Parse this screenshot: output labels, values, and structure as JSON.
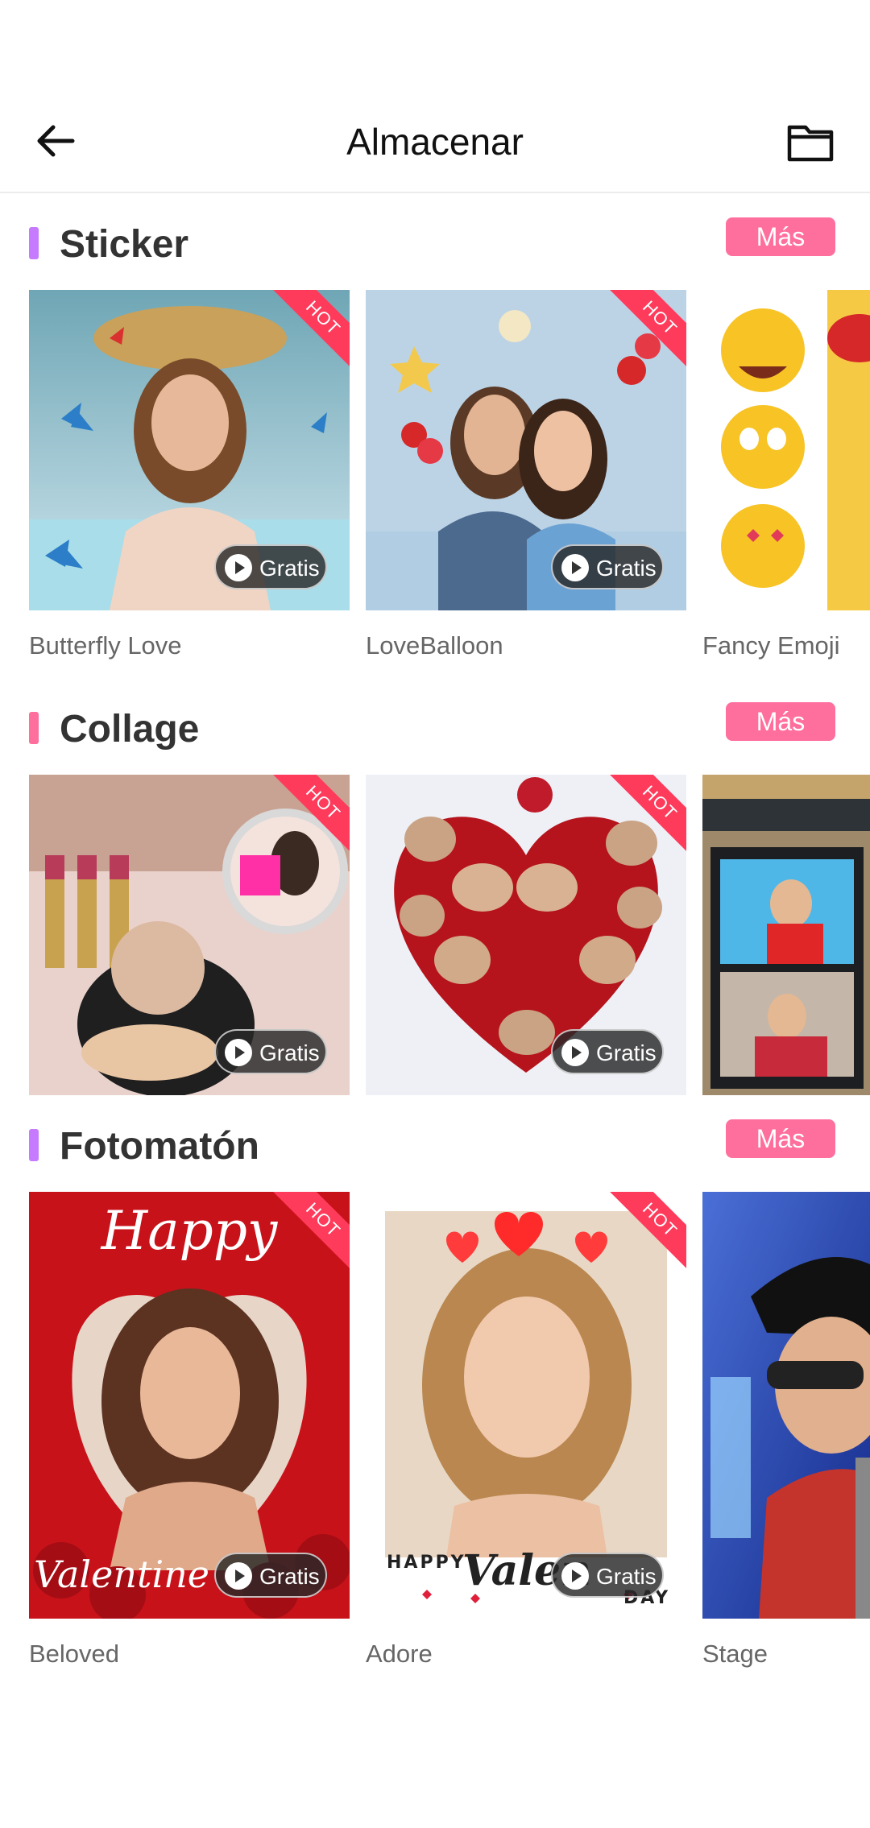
{
  "header": {
    "title": "Almacenar"
  },
  "icons": {
    "back": "arrow-left-icon",
    "folder": "folder-icon",
    "play": "play-icon"
  },
  "colors": {
    "accent": "#ff6f9e",
    "hot": "#ff3b5c",
    "sticker_bar": "#c67bff",
    "collage_bar": "#ff6f9e"
  },
  "sections": [
    {
      "title": "Sticker",
      "more": "Más",
      "items": [
        {
          "label": "Butterfly Love",
          "badge": "HOT",
          "price": "Gratis"
        },
        {
          "label": "LoveBalloon",
          "badge": "HOT",
          "price": "Gratis"
        },
        {
          "label": "Fancy Emoji"
        }
      ]
    },
    {
      "title": "Collage",
      "more": "Más",
      "items": [
        {
          "badge": "HOT",
          "price": "Gratis"
        },
        {
          "badge": "HOT",
          "price": "Gratis"
        },
        {}
      ]
    },
    {
      "title": "Fotomatón",
      "more": "Más",
      "items": [
        {
          "label": "Beloved",
          "badge": "HOT",
          "price": "Gratis",
          "art_text_top": "Happy",
          "art_text_bottom": "Valentine"
        },
        {
          "label": "Adore",
          "badge": "HOT",
          "price": "Gratis",
          "art_text_top": "HAPPY",
          "art_text_bottom": "Valen",
          "art_text_day": "DAY"
        },
        {
          "label": "Stage"
        }
      ]
    }
  ]
}
